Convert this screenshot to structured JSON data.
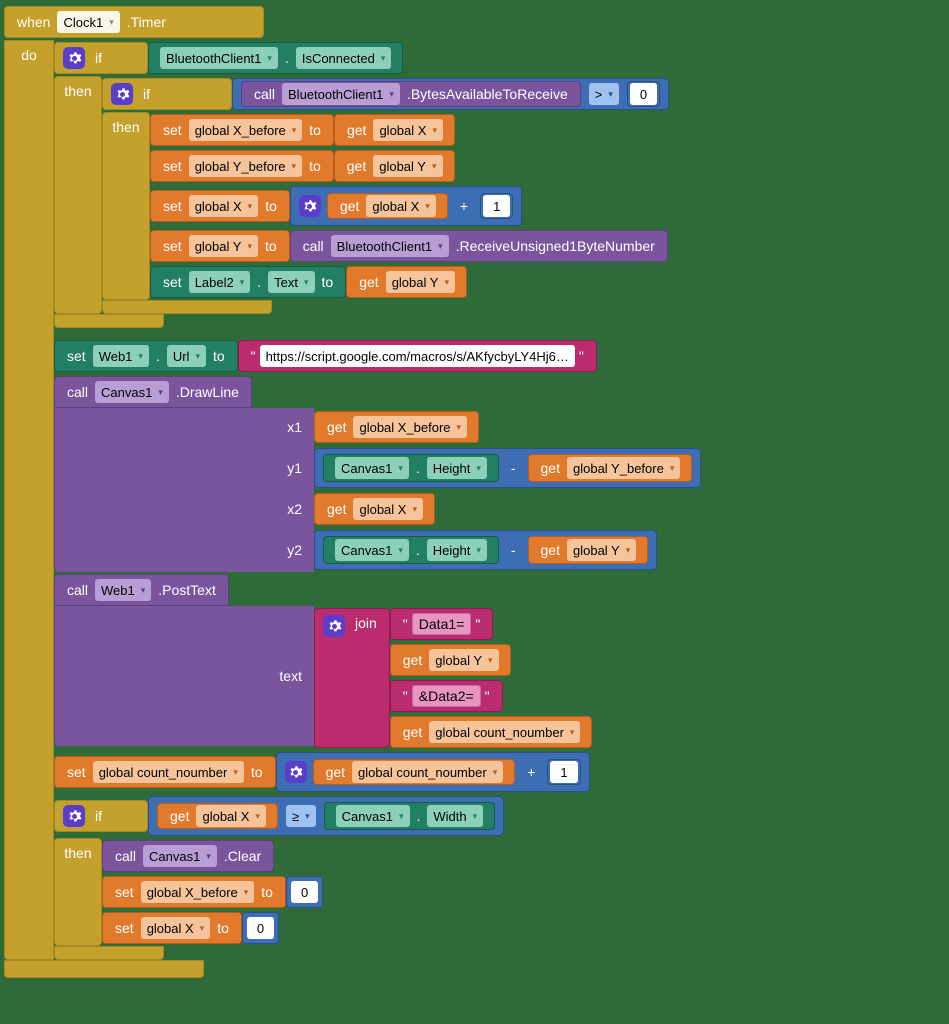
{
  "event": {
    "when": "when",
    "component": "Clock1",
    "eventName": ".Timer",
    "do": "do"
  },
  "if1": {
    "if": "if",
    "then": "then"
  },
  "bcConnected": {
    "component": "BluetoothClient1",
    "dot": ".",
    "prop": "IsConnected"
  },
  "if2": {
    "if": "if",
    "then": "then"
  },
  "bytes": {
    "call": "call",
    "component": "BluetoothClient1",
    "method": ".BytesAvailableToReceive",
    "op": ">",
    "zero": "0"
  },
  "setXB": {
    "set": "set",
    "var": "global X_before",
    "to": "to"
  },
  "getX": {
    "get": "get",
    "var": "global X"
  },
  "setYB": {
    "set": "set",
    "var": "global Y_before",
    "to": "to"
  },
  "getY": {
    "get": "get",
    "var": "global Y"
  },
  "setX": {
    "set": "set",
    "var": "global X",
    "to": "to"
  },
  "plus": "+",
  "one": "1",
  "setY": {
    "set": "set",
    "var": "global Y",
    "to": "to"
  },
  "recv": {
    "call": "call",
    "component": "BluetoothClient1",
    "method": ".ReceiveUnsigned1ByteNumber"
  },
  "setLabel": {
    "set": "set",
    "comp": "Label2",
    "dot": ".",
    "prop": "Text",
    "to": "to"
  },
  "setWeb": {
    "set": "set",
    "comp": "Web1",
    "dot": ".",
    "prop": "Url",
    "to": "to",
    "url": "https://script.google.com/macros/s/AKfycbyLY4Hj6…",
    "q": "\""
  },
  "drawLine": {
    "call": "call",
    "comp": "Canvas1",
    "method": ".DrawLine",
    "x1": "x1",
    "y1": "y1",
    "x2": "x2",
    "y2": "y2"
  },
  "getXB": {
    "get": "get",
    "var": "global X_before"
  },
  "getYB": {
    "get": "get",
    "var": "global Y_before"
  },
  "canvasH": {
    "comp": "Canvas1",
    "dot": ".",
    "prop": "Height"
  },
  "minus": "-",
  "postText": {
    "call": "call",
    "comp": "Web1",
    "method": ".PostText",
    "text": "text"
  },
  "join": {
    "join": "join",
    "d1": "Data1=",
    "d2": "&Data2=",
    "q": "\""
  },
  "getCN": {
    "get": "get",
    "var": "global count_noumber"
  },
  "setCN": {
    "set": "set",
    "var": "global count_noumber",
    "to": "to"
  },
  "if3": {
    "if": "if",
    "then": "then"
  },
  "gte": "≥",
  "canvasW": {
    "comp": "Canvas1",
    "dot": ".",
    "prop": "Width"
  },
  "clear": {
    "call": "call",
    "comp": "Canvas1",
    "method": ".Clear"
  },
  "setXB0": {
    "set": "set",
    "var": "global X_before",
    "to": "to",
    "zero": "0"
  },
  "setX0": {
    "set": "set",
    "var": "global X",
    "to": "to",
    "zero": "0"
  },
  "sp": " "
}
